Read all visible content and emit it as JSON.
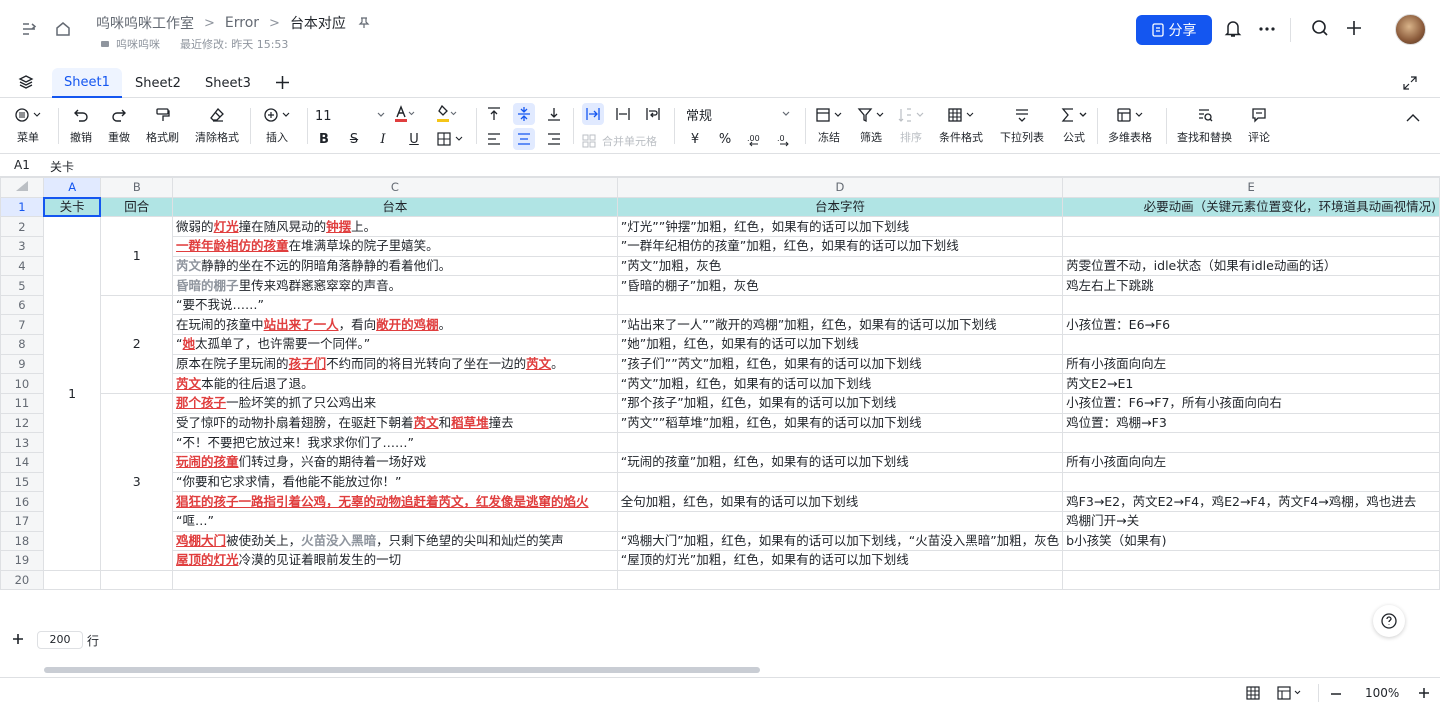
{
  "header": {
    "breadcrumbs": [
      "呜咪呜咪工作室",
      "Error",
      "台本对应"
    ],
    "owner": "呜咪呜咪",
    "last_modified": "最近修改: 昨天 15:53",
    "share_label": "分享"
  },
  "sheets": [
    "Sheet1",
    "Sheet2",
    "Sheet3"
  ],
  "toolbar": {
    "menu": "菜单",
    "undo": "撤销",
    "redo": "重做",
    "format_painter": "格式刷",
    "clear_format": "清除格式",
    "insert": "插入",
    "font_size": "11",
    "merge": "合并单元格",
    "number_format": "常规",
    "currency": "¥",
    "percent": "%",
    "freeze": "冻结",
    "filter": "筛选",
    "sort": "排序",
    "cond_format": "条件格式",
    "dropdown": "下拉列表",
    "formula": "公式",
    "multi_table": "多维表格",
    "find_replace": "查找和替换",
    "comment": "评论"
  },
  "formula_bar": {
    "cell": "A1",
    "value": "关卡"
  },
  "columns": [
    "A",
    "B",
    "C",
    "D",
    "E"
  ],
  "rows": [
    {
      "n": "1",
      "c": [
        {
          "t": "关卡"
        }
      ],
      "d": "台本字符",
      "e": "必要动画（关键元素位置变化，环境道具动画视情况)"
    },
    {
      "n": "2",
      "c": [
        {
          "t": "微弱的"
        },
        {
          "t": "灯光",
          "s": "r"
        },
        {
          "t": "撞在随风晃动的"
        },
        {
          "t": "钟摆",
          "s": "r"
        },
        {
          "t": "上。"
        }
      ],
      "d": "”灯光””钟摆”加粗，红色，如果有的话可以加下划线",
      "e": ""
    },
    {
      "n": "3",
      "c": [
        {
          "t": "一群年龄相仿的孩童",
          "s": "r"
        },
        {
          "t": "在堆满草垛的院子里嬉笑。"
        }
      ],
      "d": "”一群年纪相仿的孩童”加粗，红色，如果有的话可以加下划线",
      "e": ""
    },
    {
      "n": "4",
      "c": [
        {
          "t": "芮文",
          "s": "g"
        },
        {
          "t": "静静的坐在不远的阴暗角落静静的看着他们。"
        }
      ],
      "d": "”芮文”加粗，灰色",
      "e": "芮雯位置不动，idle状态（如果有idle动画的话）"
    },
    {
      "n": "5",
      "c": [
        {
          "t": "昏暗的棚子",
          "s": "g"
        },
        {
          "t": "里传来鸡群窸窸窣窣的声音。"
        }
      ],
      "d": "”昏暗的棚子”加粗，灰色",
      "e": "鸡左右上下跳跳"
    },
    {
      "n": "6",
      "c": [
        {
          "t": "“要不我说……”"
        }
      ],
      "d": "",
      "e": ""
    },
    {
      "n": "7",
      "c": [
        {
          "t": "在玩闹的孩童中"
        },
        {
          "t": "站出来了一人",
          "s": "r"
        },
        {
          "t": "，看向"
        },
        {
          "t": "敞开的鸡棚",
          "s": "r"
        },
        {
          "t": "。"
        }
      ],
      "d": "”站出来了一人””敞开的鸡棚”加粗，红色，如果有的话可以加下划线",
      "e": "小孩位置：E6→F6"
    },
    {
      "n": "8",
      "c": [
        {
          "t": "“"
        },
        {
          "t": "她",
          "s": "r"
        },
        {
          "t": "太孤单了，也许需要一个同伴。”"
        }
      ],
      "d": "”她”加粗，红色，如果有的话可以加下划线",
      "e": ""
    },
    {
      "n": "9",
      "c": [
        {
          "t": "原本在院子里玩闹的"
        },
        {
          "t": "孩子们",
          "s": "r"
        },
        {
          "t": "不约而同的将目光转向了坐在一边的"
        },
        {
          "t": "芮文",
          "s": "r"
        },
        {
          "t": "。"
        }
      ],
      "d": "”孩子们””芮文”加粗，红色，如果有的话可以加下划线",
      "e": "所有小孩面向向左"
    },
    {
      "n": "10",
      "c": [
        {
          "t": "芮文",
          "s": "r"
        },
        {
          "t": "本能的往后退了退。"
        }
      ],
      "d": "“芮文”加粗，红色，如果有的话可以加下划线",
      "e": "芮文E2→E1"
    },
    {
      "n": "11",
      "c": [
        {
          "t": "那个孩子",
          "s": "r"
        },
        {
          "t": "一脸坏笑的抓了只公鸡出来"
        }
      ],
      "d": "”那个孩子”加粗，红色，如果有的话可以加下划线",
      "e": "小孩位置：F6→F7，所有小孩面向向右"
    },
    {
      "n": "12",
      "c": [
        {
          "t": "受了惊吓的动物扑扇着翅膀，在驱赶下朝着"
        },
        {
          "t": "芮文",
          "s": "r"
        },
        {
          "t": "和"
        },
        {
          "t": "稻草堆",
          "s": "r"
        },
        {
          "t": "撞去"
        }
      ],
      "d": "”芮文””稻草堆”加粗，红色，如果有的话可以加下划线",
      "e": "鸡位置：鸡棚→F3"
    },
    {
      "n": "13",
      "c": [
        {
          "t": "“不！不要把它放过来！我求求你们了……”"
        }
      ],
      "d": "",
      "e": ""
    },
    {
      "n": "14",
      "c": [
        {
          "t": "玩闹的孩童",
          "s": "r"
        },
        {
          "t": "们转过身，兴奋的期待着一场好戏"
        }
      ],
      "d": "“玩闹的孩童”加粗，红色，如果有的话可以加下划线",
      "e": "所有小孩面向向左"
    },
    {
      "n": "15",
      "c": [
        {
          "t": "“你要和它求求情，看他能不能放过你！”"
        }
      ],
      "d": "",
      "e": ""
    },
    {
      "n": "16",
      "c": [
        {
          "t": "猖狂的孩子一路指引着公鸡，无辜的动物追赶着芮文，红发像是逃窜的焰火",
          "s": "r"
        }
      ],
      "d": "全句加粗，红色，如果有的话可以加下划线",
      "e": "鸡F3→E2，芮文E2→F4，鸡E2→F4，芮文F4→鸡棚，鸡也进去"
    },
    {
      "n": "17",
      "c": [
        {
          "t": "“哐…”"
        }
      ],
      "d": "",
      "e": "鸡棚门开→关"
    },
    {
      "n": "18",
      "c": [
        {
          "t": "鸡棚大门",
          "s": "r"
        },
        {
          "t": "被使劲关上，"
        },
        {
          "t": "火苗没入黑暗",
          "s": "g"
        },
        {
          "t": "，只剩下绝望的尖叫和灿烂的笑声"
        }
      ],
      "d": "“鸡棚大门”加粗，红色，如果有的话可以加下划线，“火苗没入黑暗”加粗，灰色",
      "e": "b小孩笑（如果有)"
    },
    {
      "n": "19",
      "c": [
        {
          "t": "屋顶的灯光",
          "s": "r"
        },
        {
          "t": "冷漠的见证着眼前发生的一切"
        }
      ],
      "d": "“屋顶的灯光”加粗，红色，如果有的话可以加下划线",
      "e": ""
    },
    {
      "n": "20",
      "c": [],
      "d": "",
      "e": ""
    }
  ],
  "header_row": {
    "a": "关卡",
    "b": "回合",
    "c": "台本"
  },
  "merged": {
    "level": "1",
    "round1": "1",
    "round2": "2",
    "round3": "3"
  },
  "footer": {
    "add_rows": "200",
    "rows_unit": "行",
    "zoom": "100%"
  }
}
